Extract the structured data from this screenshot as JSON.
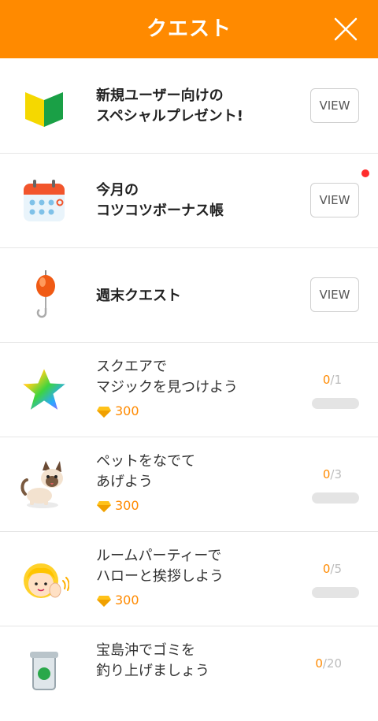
{
  "header": {
    "title": "クエスト"
  },
  "quests": [
    {
      "line1": "新規ユーザー向けの",
      "line2": "スペシャルプレゼント!",
      "button": "VIEW"
    },
    {
      "line1": "今月の",
      "line2": "コツコツボーナス帳",
      "button": "VIEW",
      "has_notification": true
    },
    {
      "line1": "週末クエスト",
      "button": "VIEW"
    },
    {
      "line1": "スクエアで",
      "line2": "マジックを見つけよう",
      "reward": "300",
      "progress_current": "0",
      "progress_total": "/1"
    },
    {
      "line1": "ペットをなでて",
      "line2": "あげよう",
      "reward": "300",
      "progress_current": "0",
      "progress_total": "/3"
    },
    {
      "line1": "ルームパーティーで",
      "line2": "ハローと挨拶しよう",
      "reward": "300",
      "progress_current": "0",
      "progress_total": "/5"
    },
    {
      "line1": "宝島沖でゴミを",
      "line2": "釣り上げましょう",
      "progress_current": "0",
      "progress_total": "/20"
    }
  ],
  "colors": {
    "accent": "#ff8a00",
    "notification": "#ff2d2d"
  },
  "icons": [
    "beginner-mark-icon",
    "calendar-icon",
    "fishing-float-icon",
    "rainbow-star-icon",
    "cat-icon",
    "waving-person-icon",
    "trash-can-icon"
  ]
}
